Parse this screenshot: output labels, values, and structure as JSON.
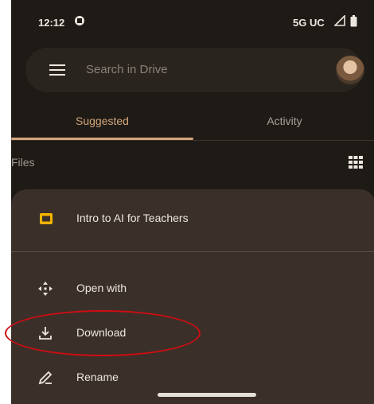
{
  "status_bar": {
    "time": "12:12",
    "network": "5G UC",
    "icons": [
      "notification-icon",
      "signal-icon",
      "battery-icon"
    ]
  },
  "search": {
    "placeholder": "Search in Drive",
    "menu_icon": "menu-icon",
    "avatar": "account-avatar"
  },
  "tabs": [
    {
      "label": "Suggested",
      "selected": true
    },
    {
      "label": "Activity",
      "selected": false
    }
  ],
  "files_section": {
    "label": "Files",
    "view_icon": "grid-view-icon"
  },
  "sheet": {
    "file": {
      "title": "Intro to AI for Teachers",
      "icon": "slides-icon"
    },
    "actions": [
      {
        "label": "Open with",
        "icon": "open-with-icon"
      },
      {
        "label": "Download",
        "icon": "download-icon"
      },
      {
        "label": "Rename",
        "icon": "rename-icon"
      }
    ]
  },
  "colors": {
    "background": "#1e1a16",
    "sheet": "#3a3029",
    "accent": "#d4a57a",
    "highlight": "#d00c12"
  }
}
